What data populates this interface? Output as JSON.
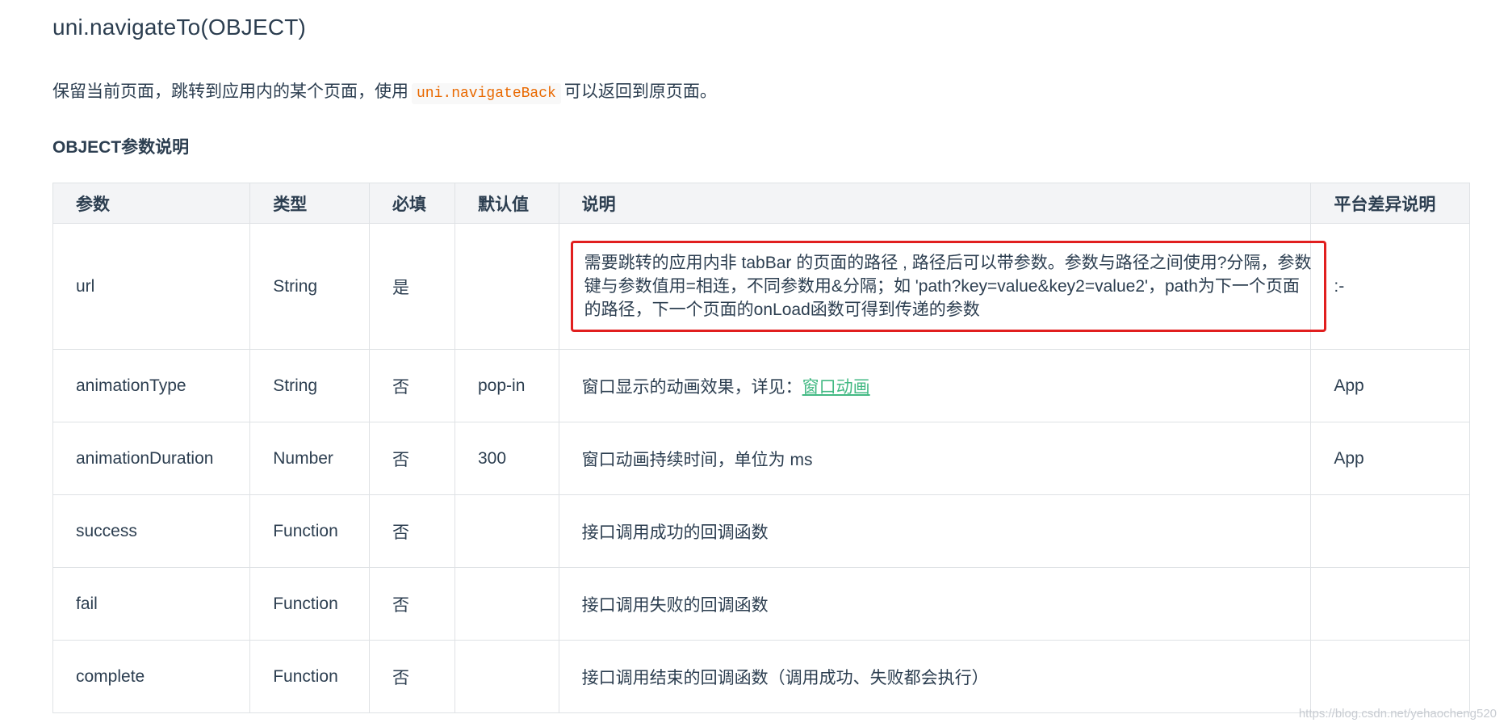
{
  "title": "uni.navigateTo(OBJECT)",
  "intro": {
    "before": "保留当前页面，跳转到应用内的某个页面，使用",
    "code": "uni.navigateBack",
    "after": "可以返回到原页面。"
  },
  "section_title": "OBJECT参数说明",
  "table": {
    "headers": [
      "参数",
      "类型",
      "必填",
      "默认值",
      "说明",
      "平台差异说明"
    ],
    "rows": [
      {
        "param": "url",
        "type": "String",
        "required": "是",
        "default": "",
        "desc": "需要跳转的应用内非 tabBar 的页面的路径 , 路径后可以带参数。参数与路径之间使用?分隔，参数键与参数值用=相连，不同参数用&分隔；如 'path?key=value&key2=value2'，path为下一个页面的路径，下一个页面的onLoad函数可得到传递的参数",
        "platform": ":-"
      },
      {
        "param": "animationType",
        "type": "String",
        "required": "否",
        "default": "pop-in",
        "desc": "窗口显示的动画效果，详见：",
        "desc_link": "窗口动画",
        "platform": "App"
      },
      {
        "param": "animationDuration",
        "type": "Number",
        "required": "否",
        "default": "300",
        "desc": "窗口动画持续时间，单位为 ms",
        "platform": "App"
      },
      {
        "param": "success",
        "type": "Function",
        "required": "否",
        "default": "",
        "desc": "接口调用成功的回调函数",
        "platform": ""
      },
      {
        "param": "fail",
        "type": "Function",
        "required": "否",
        "default": "",
        "desc": "接口调用失败的回调函数",
        "platform": ""
      },
      {
        "param": "complete",
        "type": "Function",
        "required": "否",
        "default": "",
        "desc": "接口调用结束的回调函数（调用成功、失败都会执行）",
        "platform": ""
      }
    ]
  },
  "watermark": "https://blog.csdn.net/yehaocheng520",
  "colors": {
    "text": "#2c3e50",
    "code": "#e96900",
    "link": "#42b983",
    "highlight_border": "#e11f1f",
    "header_bg": "#f3f4f6",
    "border": "#dfe2e5"
  }
}
